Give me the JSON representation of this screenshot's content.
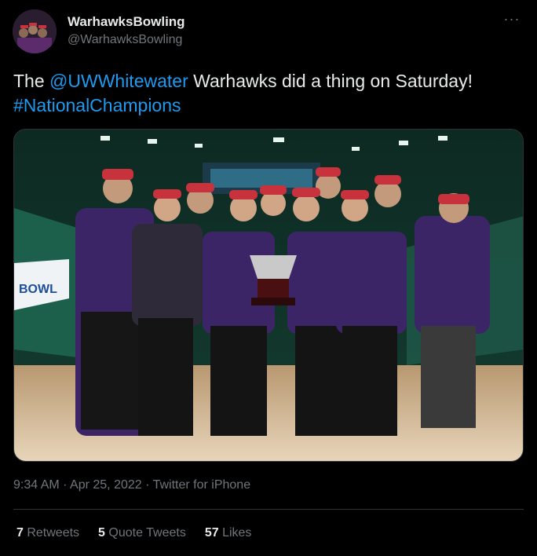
{
  "tweet": {
    "display_name": "WarhawksBowling",
    "handle": "@WarhawksBowling",
    "more_icon": "···",
    "text_part1": "The ",
    "mention": "@UWWhitewater",
    "text_part2": " Warhawks did a thing on Saturday!  ",
    "hashtag": "#NationalChampions",
    "media_icon": "photo",
    "timestamp": "9:34 AM · Apr 25, 2022 · Twitter for iPhone"
  },
  "stats": {
    "retweets_count": "7",
    "retweets_label": " Retweets",
    "quotes_count": "5",
    "quotes_label": " Quote Tweets",
    "likes_count": "57",
    "likes_label": " Likes"
  },
  "colors": {
    "background": "#000000",
    "text": "#e7e9ea",
    "secondary": "#71767b",
    "link": "#1d9bf0"
  }
}
